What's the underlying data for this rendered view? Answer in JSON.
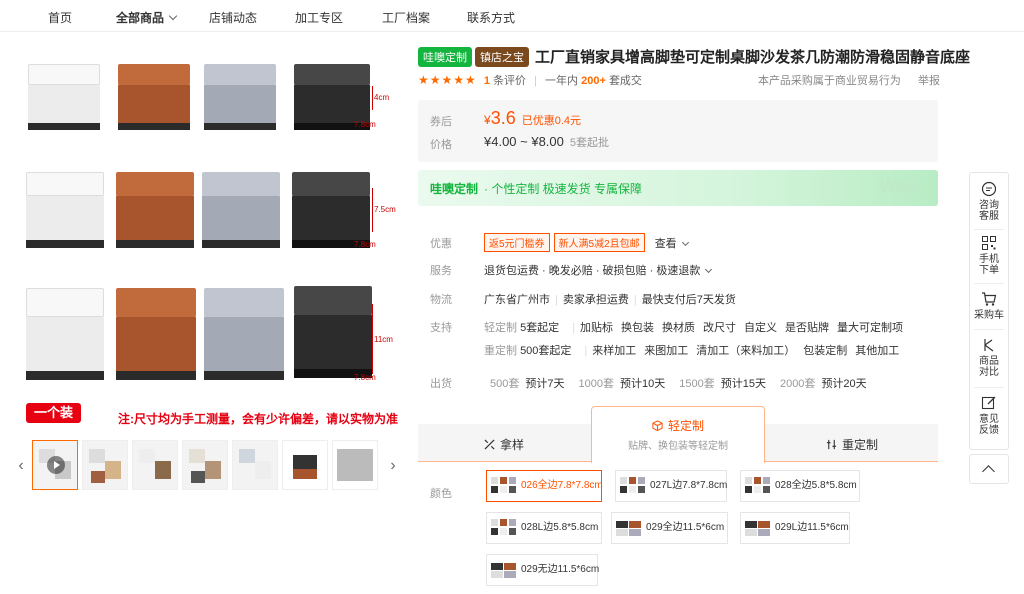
{
  "nav": {
    "items": [
      {
        "label": "首页"
      },
      {
        "label": "全部商品"
      },
      {
        "label": "店铺动态"
      },
      {
        "label": "加工专区"
      },
      {
        "label": "工厂档案"
      },
      {
        "label": "联系方式"
      }
    ]
  },
  "gallery": {
    "dims": {
      "row1_h": "4cm",
      "row1_w": "7.8cm",
      "row2_h": "7.5cm",
      "row2_w": "7.8cm",
      "row3_h": "11cm",
      "row3_w": "7.8cm"
    },
    "tag": "一个装",
    "note": "注:尺寸均为手工测量，会有少许偏差，请以实物为准",
    "prev": "‹",
    "next": "›"
  },
  "product": {
    "badge1": "哇噢定制",
    "badge2": "镇店之宝",
    "title": "工厂直销家具增高脚垫可定制桌脚沙发茶几防潮防滑稳固静音底座",
    "stars": "★★★★★",
    "review_count": "1",
    "review_label": "条评价",
    "sales_prefix": "一年内",
    "sales_count": "200+",
    "sales_suffix": "套成交",
    "trade_note": "本产品采购属于商业贸易行为",
    "report": "举报"
  },
  "price": {
    "coupon_label": "券后",
    "currency": "¥",
    "after_price": "3.6",
    "discount": "已优惠0.4元",
    "price_label": "价格",
    "range": "¥4.00 ~ ¥8.00",
    "min_order": "5套起批"
  },
  "banner": {
    "brand": "哇噢定制",
    "desc": "· 个性定制 极速发货 专属保障",
    "watermark": "Waw"
  },
  "offers": {
    "label": "优惠",
    "coupons": [
      "返5元门槛券",
      "新人满5减2且包邮"
    ],
    "more": "查看"
  },
  "service": {
    "label": "服务",
    "value": "退货包运费 · 晚发必赔 · 破损包赔 · 极速退款"
  },
  "logistics": {
    "label": "物流",
    "origin": "广东省广州市",
    "fee": "卖家承担运费",
    "delivery": "最快支付后7天发货"
  },
  "support": {
    "label": "支持",
    "light_label": "轻定制",
    "light_min": "5套起定",
    "light_opts": [
      "加贴标",
      "换包装",
      "换材质",
      "改尺寸",
      "自定义",
      "是否贴牌",
      "量大可定制项"
    ],
    "heavy_label": "重定制",
    "heavy_min": "500套起定",
    "heavy_opts": [
      "来样加工",
      "来图加工",
      "清加工（来料加工）",
      "包装定制",
      "其他加工"
    ]
  },
  "shipping": {
    "label": "出货",
    "tiers": [
      {
        "qty": "500套",
        "days": "预计7天"
      },
      {
        "qty": "1000套",
        "days": "预计10天"
      },
      {
        "qty": "1500套",
        "days": "预计15天"
      },
      {
        "qty": "2000套",
        "days": "预计20天"
      }
    ]
  },
  "tabs": [
    {
      "label": "拿样",
      "icon": "sample-icon"
    },
    {
      "label": "轻定制",
      "sub": "贴牌、换包装等轻定制",
      "icon": "box-icon"
    },
    {
      "label": "重定制",
      "icon": "adjust-icon"
    }
  ],
  "colors": {
    "label": "颜色",
    "options": [
      {
        "label": "026全边7.8*7.8cm"
      },
      {
        "label": "027L边7.8*7.8cm"
      },
      {
        "label": "028全边5.8*5.8cm"
      },
      {
        "label": "028L边5.8*5.8cm"
      },
      {
        "label": "029全边11.5*6cm"
      },
      {
        "label": "029L边11.5*6cm"
      },
      {
        "label": "029无边11.5*6cm"
      }
    ]
  },
  "sidebar": {
    "consult": "咨询客服",
    "mobile": "手机下单",
    "cart": "采购车",
    "compare": "商品对比",
    "feedback": "意见反馈"
  },
  "accent": "#ff5000",
  "brand_green": "#14b53e"
}
